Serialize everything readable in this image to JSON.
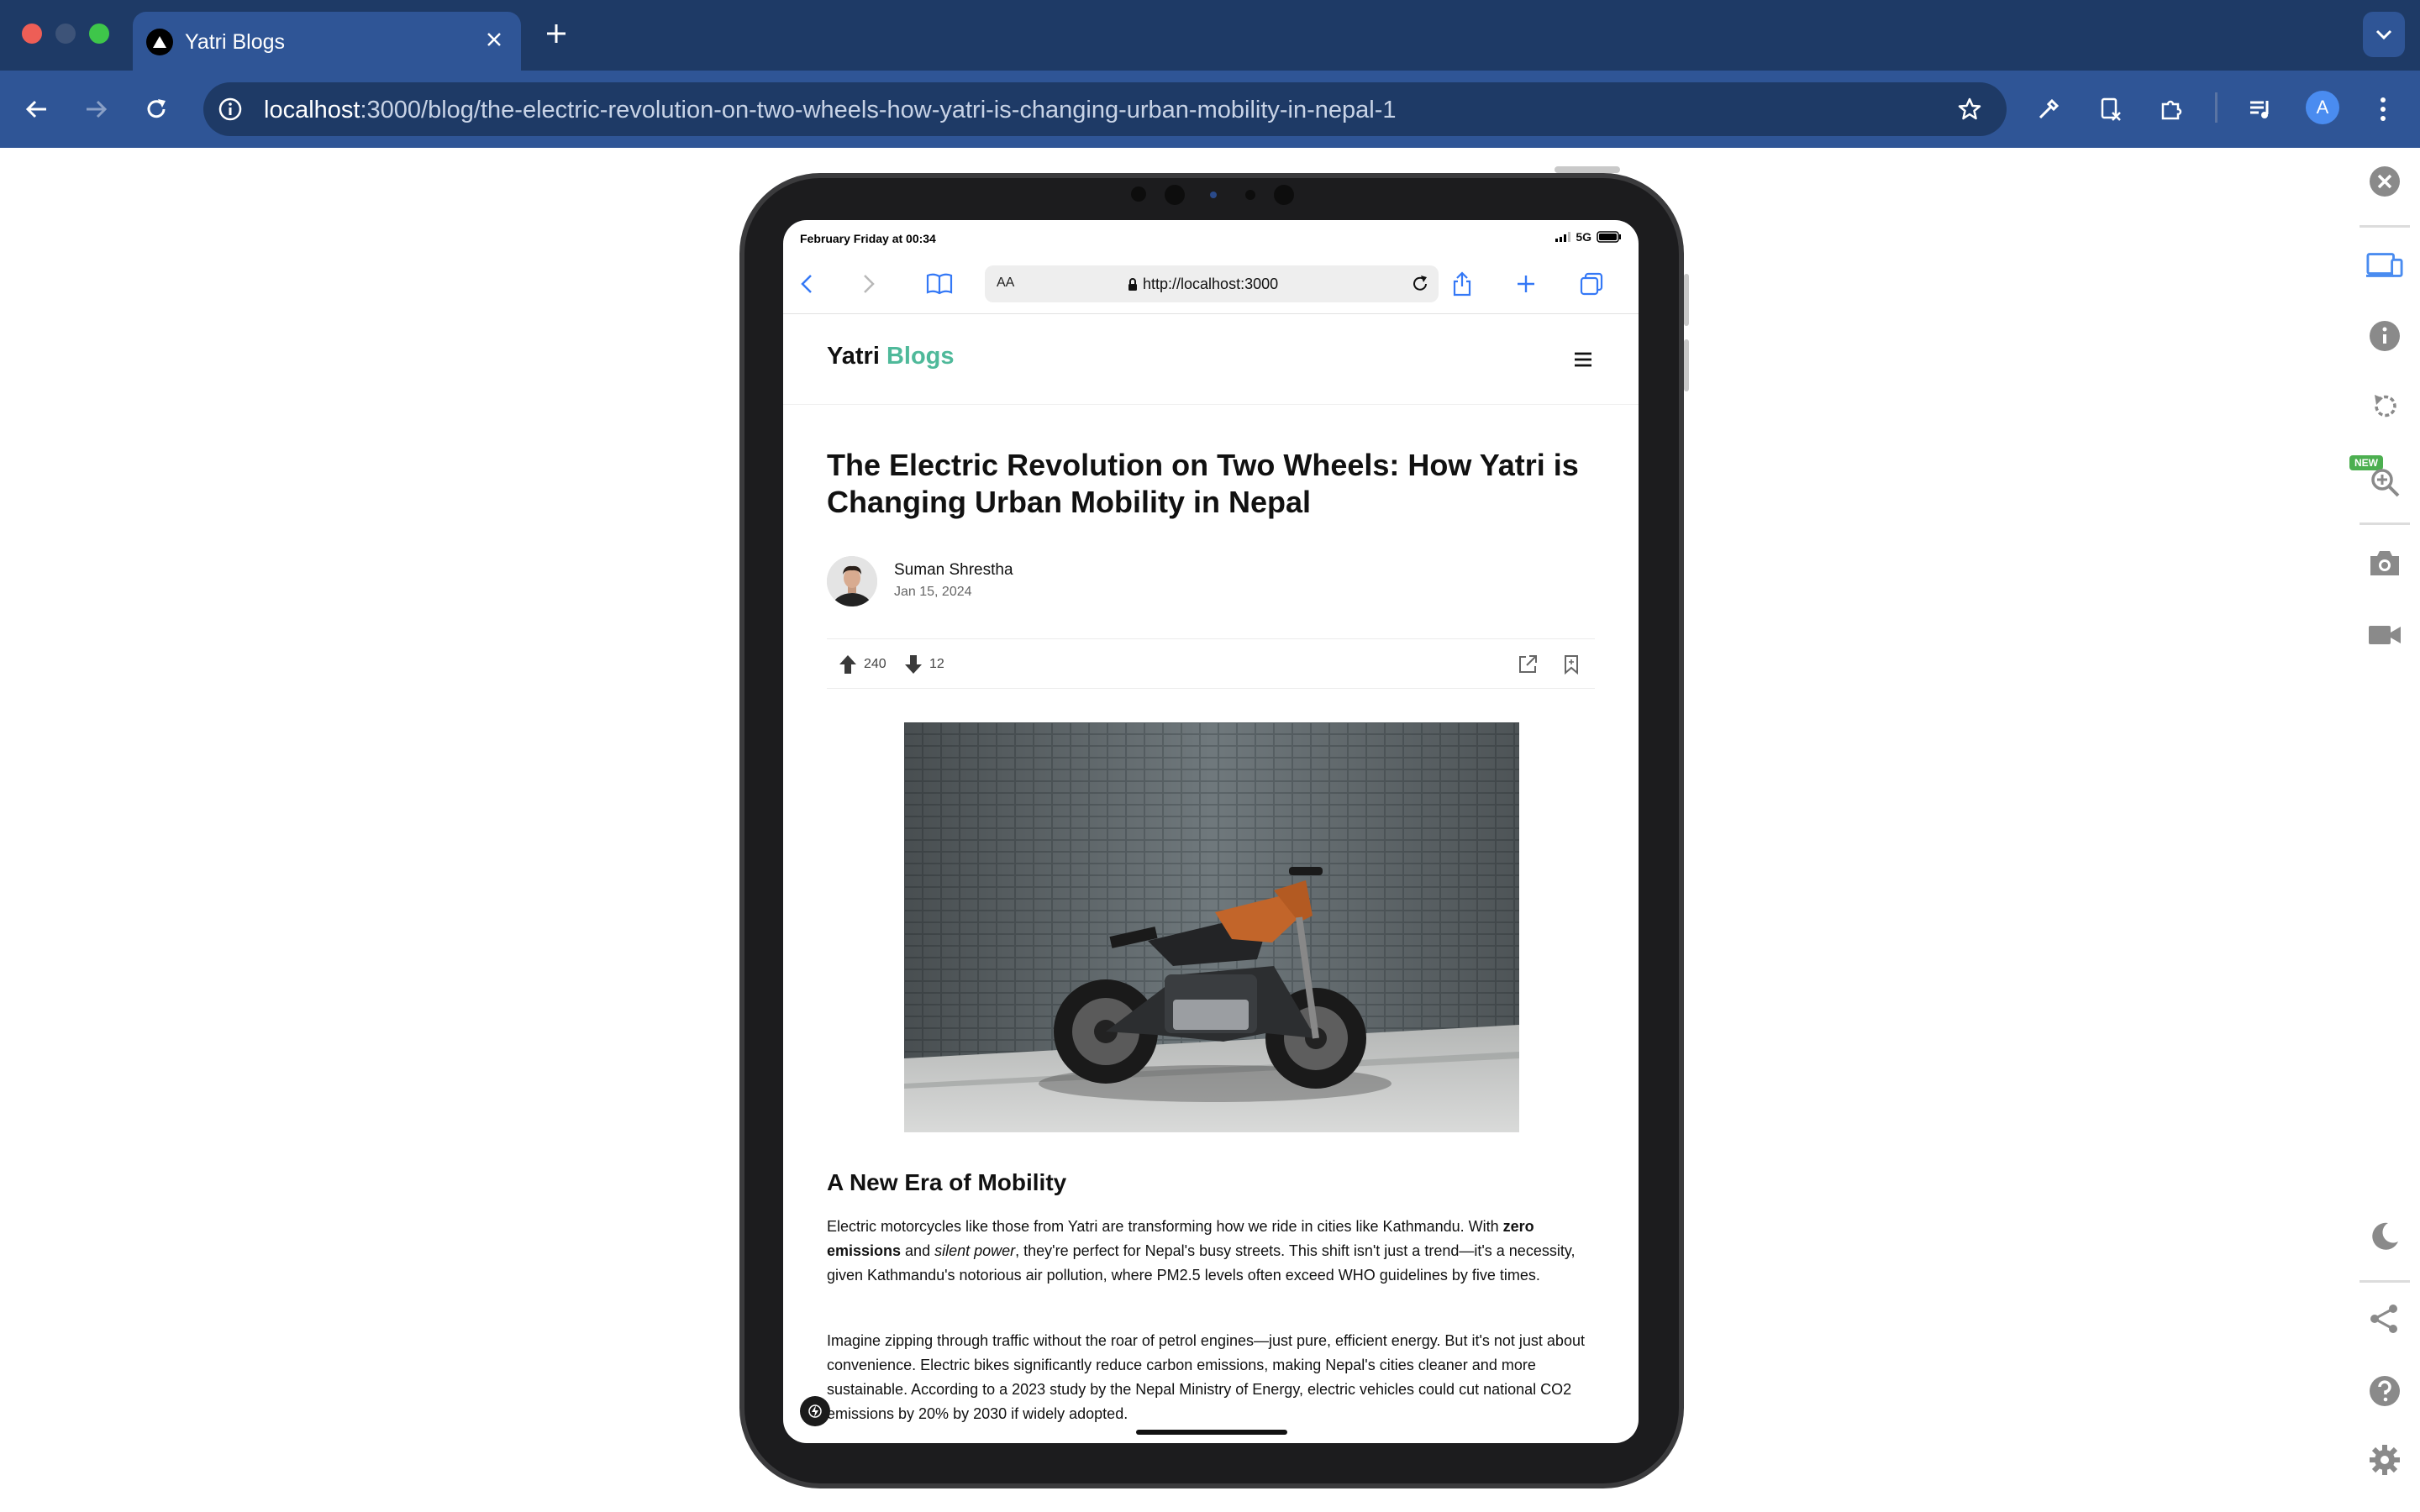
{
  "browser": {
    "tab_title": "Yatri Blogs",
    "url_host": "localhost",
    "url_rest": ":3000/blog/the-electric-revolution-on-two-wheels-how-yatri-is-changing-urban-mobility-in-nepal-1",
    "profile_initial": "A"
  },
  "device": {
    "status_time": "February Friday at 00:34",
    "network": "5G",
    "safari": {
      "text_size_label": "AA",
      "address": "http://localhost:3000"
    }
  },
  "site": {
    "logo_primary": "Yatri",
    "logo_accent": "Blogs"
  },
  "article": {
    "title": "The Electric Revolution on Two Wheels: How Yatri is Changing Urban Mobility in Nepal",
    "author": "Suman Shrestha",
    "date": "Jan 15, 2024",
    "upvotes": "240",
    "downvotes": "12",
    "section_heading": "A New Era of Mobility",
    "p1": {
      "a": "Electric motorcycles like those from Yatri are transforming how we ride in cities like Kathmandu. With ",
      "b": "zero emissions",
      "c": " and ",
      "d": "silent power",
      "e": ", they're perfect for Nepal's busy streets. This shift isn't just a trend—it's a necessity, given Kathmandu's notorious air pollution, where PM2.5 levels often exceed WHO guidelines by five times."
    },
    "p2": "Imagine zipping through traffic without the roar of petrol engines—just pure, efficient energy. But it's not just about convenience. Electric bikes significantly reduce carbon emissions, making Nepal's cities cleaner and more sustainable. According to a 2023 study by the Nepal Ministry of Energy, electric vehicles could cut national CO2 emissions by 20% by 2030 if widely adopted."
  },
  "sidebar": {
    "new_badge": "NEW"
  },
  "colors": {
    "tabbar": "#1e3a66",
    "toolbar": "#2f5596",
    "accent": "#4fb99a",
    "sidebar_icon": "#8a8a8a"
  }
}
